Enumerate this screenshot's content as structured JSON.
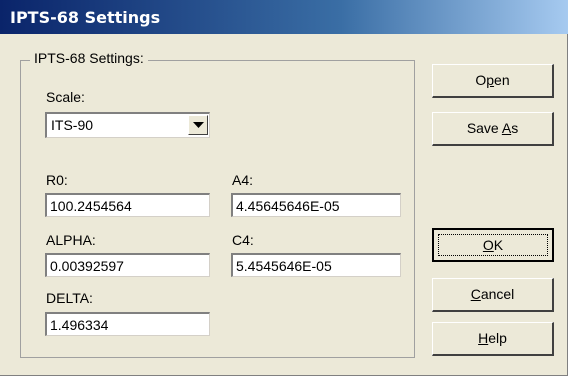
{
  "window": {
    "title": "IPTS-68 Settings"
  },
  "group": {
    "label": "IPTS-68 Settings:"
  },
  "scale": {
    "label": "Scale:",
    "selected": "ITS-90"
  },
  "fields": {
    "r0": {
      "label": "R0:",
      "value": "100.2454564"
    },
    "a4": {
      "label": "A4:",
      "value": "4.45645646E-05"
    },
    "alpha": {
      "label": "ALPHA:",
      "value": "0.00392597"
    },
    "c4": {
      "label": "C4:",
      "value": "5.4545646E-05"
    },
    "delta": {
      "label": "DELTA:",
      "value": "1.496334"
    }
  },
  "buttons": {
    "open": {
      "pre": "O",
      "mnemonic": "p",
      "post": "en"
    },
    "save_as": {
      "pre": "Save ",
      "mnemonic": "A",
      "post": "s"
    },
    "ok": {
      "pre": "",
      "mnemonic": "O",
      "post": "K"
    },
    "cancel": {
      "pre": "",
      "mnemonic": "C",
      "post": "ancel"
    },
    "help": {
      "pre": "",
      "mnemonic": "H",
      "post": "elp"
    }
  },
  "icons": {
    "dropdown": "chevron-down-icon"
  }
}
